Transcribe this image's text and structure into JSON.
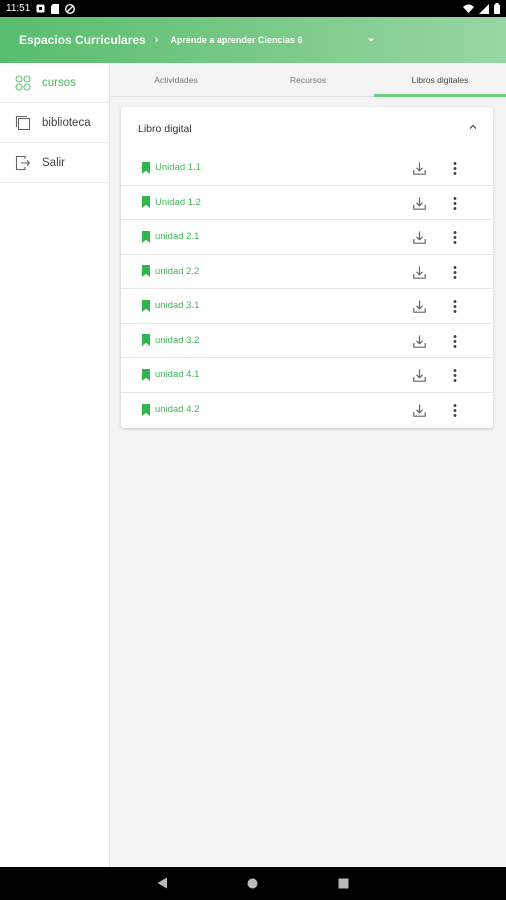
{
  "status_bar": {
    "time": "11:51",
    "left_icons": [
      "notification-icon",
      "sd-card-icon",
      "vpn-icon"
    ],
    "right_icons": [
      "wifi-icon",
      "signal-icon",
      "battery-icon"
    ]
  },
  "header": {
    "title": "Espacios Curriculares",
    "separator_icon": "chevron-right-icon",
    "course": "Aprende a aprender Ciencias 6",
    "dropdown_icon": "caret-down-icon",
    "accent": "#58bd6d"
  },
  "sidebar": {
    "items": [
      {
        "label": "cursos",
        "icon": "grid-circles-icon",
        "active": true
      },
      {
        "label": "biblioteca",
        "icon": "library-icon",
        "active": false
      },
      {
        "label": "Salir",
        "icon": "logout-icon",
        "active": false
      }
    ]
  },
  "tabs": [
    {
      "label": "Actividades",
      "active": false
    },
    {
      "label": "Recursos",
      "active": false
    },
    {
      "label": "Libros digitales",
      "active": true
    }
  ],
  "card": {
    "title": "Libro digital",
    "collapse_icon": "chevron-up-icon",
    "rows": [
      {
        "label": "Unidad 1.1"
      },
      {
        "label": "Unidad 1.2"
      },
      {
        "label": "unidad 2.1"
      },
      {
        "label": "unidad 2.2"
      },
      {
        "label": "unidad 3.1"
      },
      {
        "label": "unidad 3.2"
      },
      {
        "label": "unidad 4.1"
      },
      {
        "label": "unidad 4.2"
      }
    ],
    "row_icons": {
      "bookmark": "bookmark-icon",
      "download": "download-icon",
      "more": "more-vert-icon"
    },
    "link_color": "#3fb85a"
  },
  "nav_bar": {
    "icons": [
      "back-icon",
      "home-icon",
      "recents-icon"
    ]
  }
}
